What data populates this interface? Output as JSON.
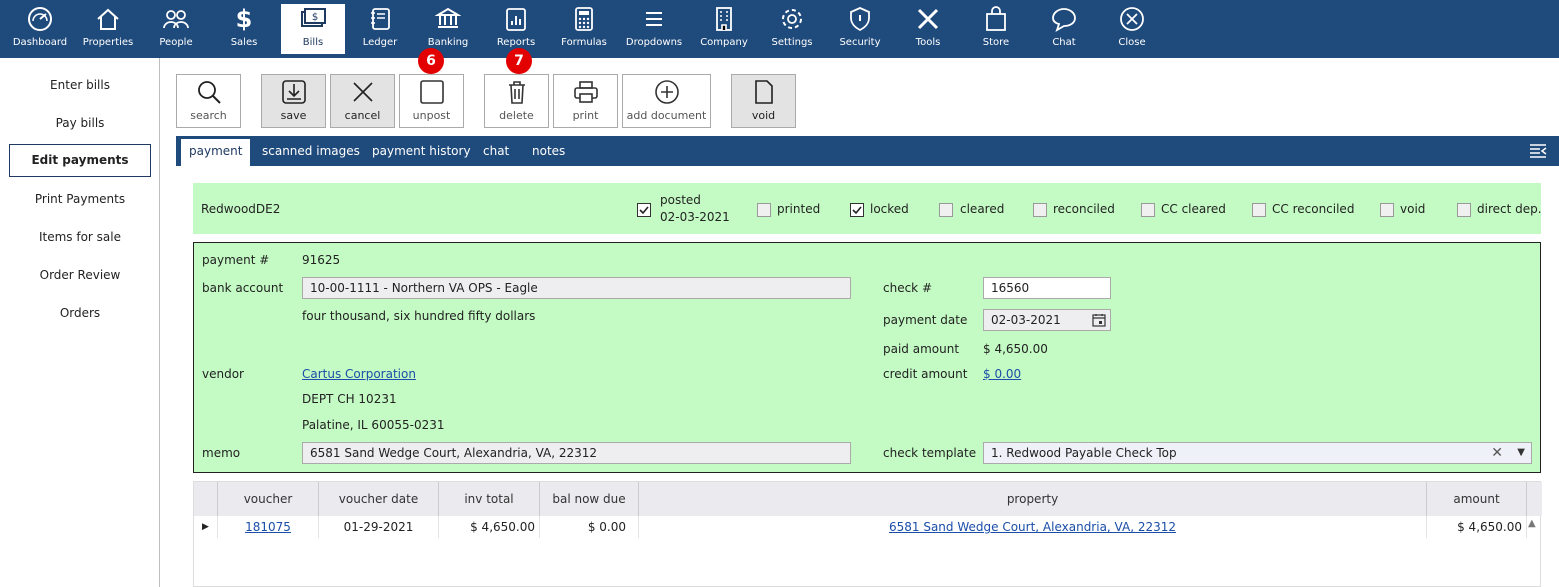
{
  "nav": [
    {
      "label": "Dashboard",
      "icon": "dashboard-icon"
    },
    {
      "label": "Properties",
      "icon": "house-icon"
    },
    {
      "label": "People",
      "icon": "people-icon"
    },
    {
      "label": "Sales",
      "icon": "dollar-icon"
    },
    {
      "label": "Bills",
      "icon": "bills-icon",
      "active": true
    },
    {
      "label": "Ledger",
      "icon": "ledger-icon"
    },
    {
      "label": "Banking",
      "icon": "bank-icon"
    },
    {
      "label": "Reports",
      "icon": "reports-icon"
    },
    {
      "label": "Formulas",
      "icon": "calculator-icon"
    },
    {
      "label": "Dropdowns",
      "icon": "menu-icon"
    },
    {
      "label": "Company",
      "icon": "building-icon"
    },
    {
      "label": "Settings",
      "icon": "gear-icon"
    },
    {
      "label": "Security",
      "icon": "shield-icon"
    },
    {
      "label": "Tools",
      "icon": "tools-icon"
    },
    {
      "label": "Store",
      "icon": "bag-icon"
    },
    {
      "label": "Chat",
      "icon": "chat-icon"
    },
    {
      "label": "Close",
      "icon": "close-icon"
    }
  ],
  "badges": [
    "6",
    "7"
  ],
  "sidebar": {
    "items": [
      "Enter bills",
      "Pay bills",
      "Edit payments",
      "Print Payments",
      "Items for sale",
      "Order Review",
      "Orders"
    ]
  },
  "toolbar": {
    "search": "search",
    "save": "save",
    "cancel": "cancel",
    "unpost": "unpost",
    "delete": "delete",
    "print": "print",
    "add_document": "add document",
    "void": "void"
  },
  "tabs": [
    "payment",
    "scanned images",
    "payment history",
    "chat",
    "notes"
  ],
  "status": {
    "name": "RedwoodDE2",
    "posted_label": "posted",
    "posted_date": "02-03-2021",
    "printed": "printed",
    "locked": "locked",
    "cleared": "cleared",
    "reconciled": "reconciled",
    "cc_cleared": "CC cleared",
    "cc_reconciled": "CC reconciled",
    "void": "void",
    "direct_dep": "direct dep."
  },
  "payment": {
    "payment_num_label": "payment #",
    "payment_num": "91625",
    "bank_account_label": "bank account",
    "bank_account": "10-00-1111 - Northern VA OPS - Eagle",
    "amount_words": "four thousand, six hundred fifty dollars",
    "check_num_label": "check #",
    "check_num": "16560",
    "payment_date_label": "payment date",
    "payment_date": "02-03-2021",
    "paid_amount_label": "paid amount",
    "paid_amount": "$ 4,650.00",
    "vendor_label": "vendor",
    "vendor": "Cartus Corporation",
    "address1": "DEPT CH 10231",
    "address2": "Palatine, IL 60055-0231",
    "credit_amount_label": "credit amount",
    "credit_amount": "$ 0.00",
    "memo_label": "memo",
    "memo": "6581 Sand Wedge Court, Alexandria, VA, 22312",
    "check_template_label": "check template",
    "check_template": "1. Redwood Payable Check Top"
  },
  "grid": {
    "headers": [
      "voucher",
      "voucher date",
      "inv total",
      "bal now due",
      "property",
      "amount"
    ],
    "rows": [
      {
        "voucher": "181075",
        "voucher_date": "01-29-2021",
        "inv_total": "$ 4,650.00",
        "bal_now_due": "$ 0.00",
        "property": "6581 Sand Wedge Court, Alexandria, VA, 22312",
        "amount": "$ 4,650.00"
      }
    ]
  },
  "colors": {
    "navbar": "#1f4a7c",
    "panel_green": "#c4fbc4",
    "badge_red": "#e30000",
    "link": "#1a4ea8"
  }
}
